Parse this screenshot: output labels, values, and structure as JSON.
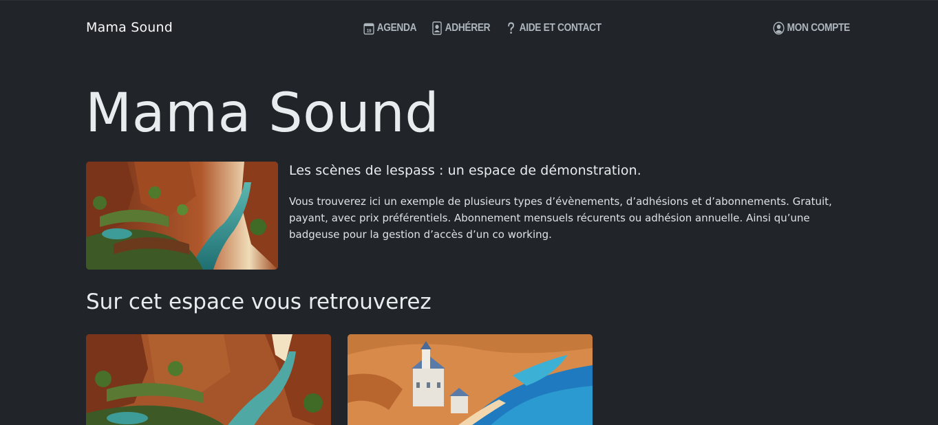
{
  "navbar": {
    "brand": "Mama Sound",
    "links": [
      {
        "label": "AGENDA",
        "icon": "calendar-icon",
        "icon_text": "19"
      },
      {
        "label": "ADHÉRER",
        "icon": "member-card-icon"
      },
      {
        "label": "AIDE ET CONTACT",
        "icon": "question-icon"
      }
    ],
    "account": {
      "label": "MON COMPTE",
      "icon": "user-circle-icon"
    }
  },
  "hero": {
    "title": "Mama Sound",
    "subtitle": "Les scènes de lespass : un espace de démonstration.",
    "description": "Vous trouverez ici un exemple de plusieurs types d’évènements, d’adhésions et d’abonnements. Gratuit, payant, avec prix préférentiels. Abonnement mensuels récurents ou adhésion annuelle. Ainsi qu’une badgeuse pour la gestion d’accès d’un co working."
  },
  "section": {
    "title": "Sur cet espace vous retrouverez"
  },
  "colors": {
    "background": "#212529",
    "text": "#dee2e6",
    "nav_text": "#adb5bd"
  }
}
